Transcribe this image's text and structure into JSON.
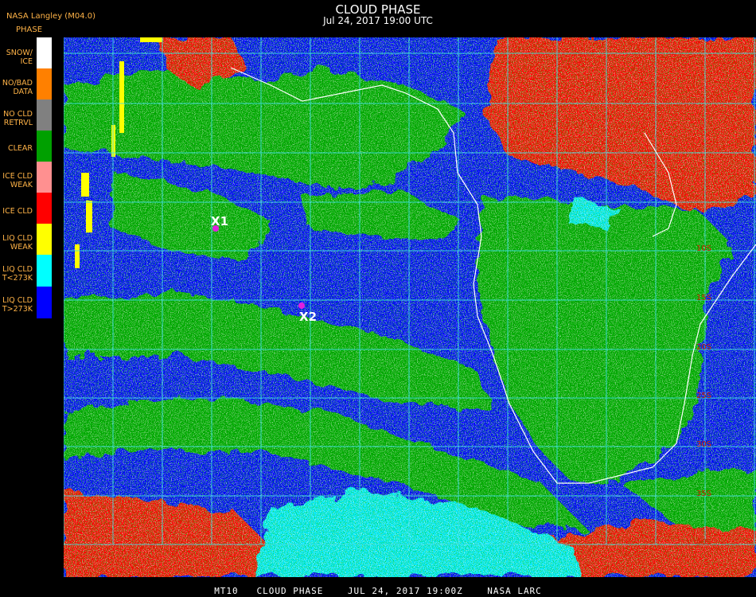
{
  "header": {
    "title": "CLOUD PHASE",
    "subtitle": "Jul 24, 2017 19:00 UTC",
    "product": "NASA Langley (M04.0)"
  },
  "legend": {
    "title": "PHASE",
    "items": [
      {
        "label": "SNOW/\nICE",
        "color": "#ffffff"
      },
      {
        "label": "NO/BAD\nDATA",
        "color": "#ff8000"
      },
      {
        "label": "NO CLD\nRETRVL",
        "color": "#808080"
      },
      {
        "label": "CLEAR",
        "color": "#00a000"
      },
      {
        "label": "ICE CLD\nWEAK",
        "color": "#ff9090"
      },
      {
        "label": "ICE CLD",
        "color": "#ff0000"
      },
      {
        "label": "LIQ CLD\nWEAK",
        "color": "#ffff00"
      },
      {
        "label": "LIQ CLD\nT<273K",
        "color": "#00ffff"
      },
      {
        "label": "LIQ CLD\nT>273K",
        "color": "#0000ff"
      }
    ]
  },
  "map": {
    "markers": [
      {
        "label": "X1"
      },
      {
        "label": "X2"
      }
    ],
    "lat_labels": [
      "10S",
      "15S",
      "20S",
      "25S",
      "30S",
      "35S",
      "40S"
    ],
    "grid_color": "#40e0e0",
    "coast_color": "#ffffff"
  },
  "footer": {
    "text": "MT10   CLOUD PHASE    JUL 24, 2017 19:00Z    NASA LARC"
  }
}
